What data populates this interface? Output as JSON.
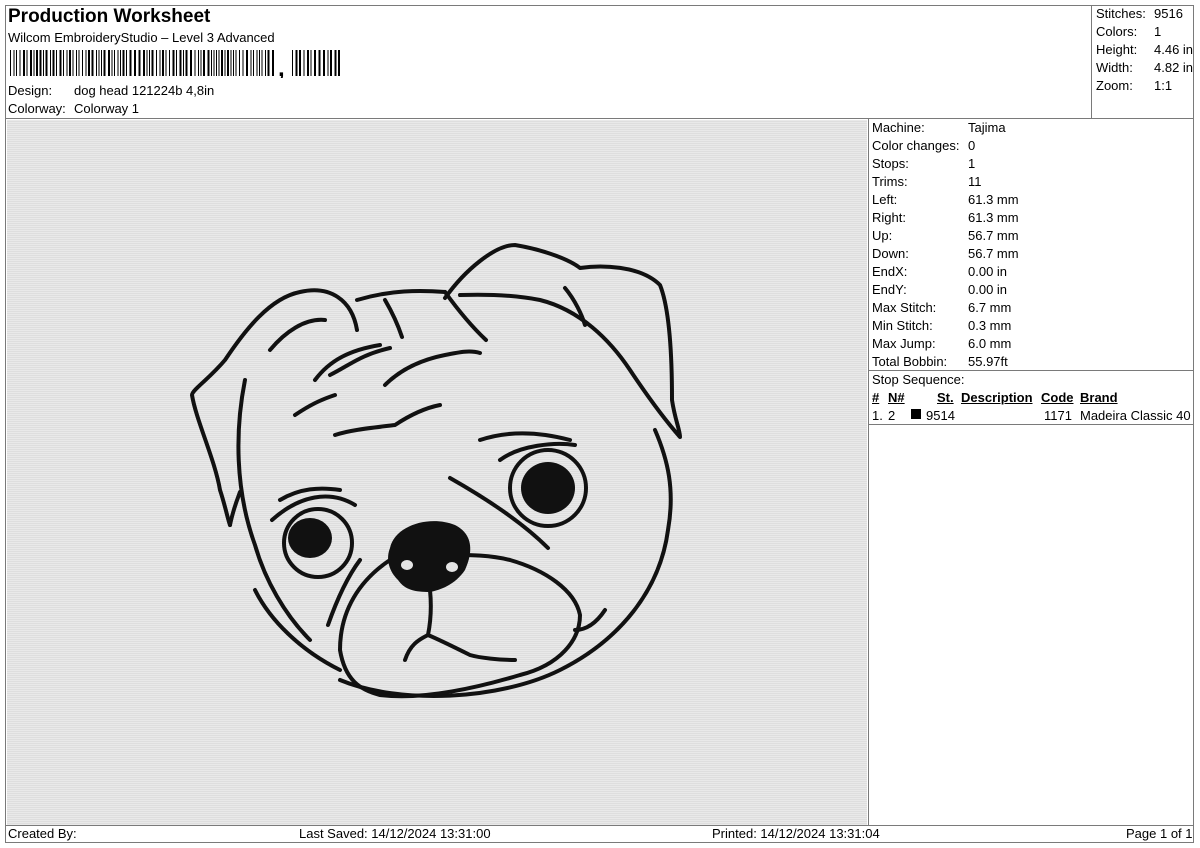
{
  "header": {
    "title": "Production Worksheet",
    "software": "Wilcom EmbroideryStudio – Level 3 Advanced",
    "barcode_suffix": ",",
    "design_label": "Design:",
    "design_value": "dog head 121224b 4,8in",
    "colorway_label": "Colorway:",
    "colorway_value": "Colorway 1"
  },
  "summary": [
    {
      "label": "Stitches:",
      "value": "9516"
    },
    {
      "label": "Colors:",
      "value": "1"
    },
    {
      "label": "Height:",
      "value": "4.46 in"
    },
    {
      "label": "Width:",
      "value": "4.82 in"
    },
    {
      "label": "Zoom:",
      "value": "1:1"
    }
  ],
  "machine_info": [
    {
      "label": "Machine:",
      "value": "Tajima"
    },
    {
      "label": "Color changes:",
      "value": "0"
    },
    {
      "label": "Stops:",
      "value": "1"
    },
    {
      "label": "Trims:",
      "value": "11"
    },
    {
      "label": "Left:",
      "value": "61.3 mm"
    },
    {
      "label": "Right:",
      "value": "61.3 mm"
    },
    {
      "label": "Up:",
      "value": "56.7 mm"
    },
    {
      "label": "Down:",
      "value": "56.7 mm"
    },
    {
      "label": "EndX:",
      "value": "0.00 in"
    },
    {
      "label": "EndY:",
      "value": "0.00 in"
    },
    {
      "label": "Max Stitch:",
      "value": "6.7 mm"
    },
    {
      "label": "Min Stitch:",
      "value": "0.3 mm"
    },
    {
      "label": "Max Jump:",
      "value": "6.0 mm"
    },
    {
      "label": "Total Bobbin:",
      "value": "55.97ft"
    }
  ],
  "stop_sequence": {
    "label": "Stop Sequence:",
    "columns": [
      "#",
      "N#",
      "St.",
      "Description",
      "Code",
      "Brand"
    ],
    "rows": [
      {
        "num": "1.",
        "n": "2",
        "color": "#000000",
        "st": "9514",
        "description": "",
        "code": "1171",
        "brand": "Madeira Classic 40"
      }
    ]
  },
  "footer": {
    "created_by": "Created By:",
    "last_saved": "Last Saved: 14/12/2024 13:31:00",
    "printed": "Printed: 14/12/2024 13:31:04",
    "page": "Page 1 of 1"
  },
  "colors": {
    "thread": "#000000",
    "canvas": "#e4e4e4",
    "border": "#7a7a7a"
  },
  "icons": {
    "design_preview": "pug-dog-head-embroidery"
  }
}
